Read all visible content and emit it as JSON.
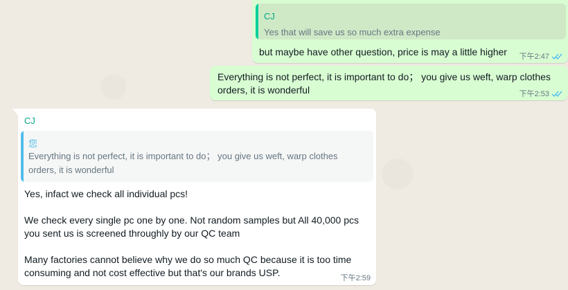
{
  "colors": {
    "background": "#efeae2",
    "outgoing_bubble": "#d9fdd3",
    "incoming_bubble": "#ffffff",
    "read_ticks": "#53bdeb",
    "sender_name": "#06a884"
  },
  "messages": [
    {
      "direction": "outgoing",
      "quote": {
        "sender": "CJ",
        "text": "Yes that will save us so much extra expense"
      },
      "text": "but maybe have other question, price is may a little higher",
      "time": "下午2:47",
      "status_icon": "double-check-read-icon"
    },
    {
      "direction": "outgoing",
      "text": "Everything is not perfect, it is important to do；  you give us weft, warp clothes orders, it is wonderful",
      "time": "下午2:53",
      "status_icon": "double-check-read-icon"
    },
    {
      "direction": "incoming",
      "sender": "CJ",
      "quote": {
        "sender": "您",
        "text": "Everything is not perfect, it is important to do；  you give us weft, warp clothes orders, it is wonderful"
      },
      "paragraphs": [
        "Yes, infact we check all individual pcs!",
        "We check every single pc one by one. Not random samples but All 40,000 pcs you sent us is screened throughly by our QC team",
        "Many factories cannot believe why we do so much QC because it is too time consuming and not cost effective but that's our brands USP."
      ],
      "time": "下午2:59"
    }
  ]
}
